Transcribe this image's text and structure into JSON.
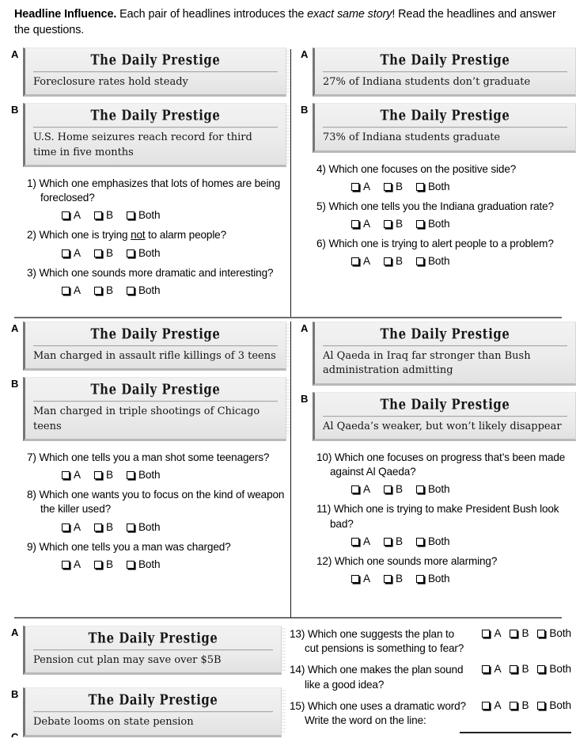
{
  "header": {
    "lead": "Headline Influence.",
    "text_before_italic": " Each pair of headlines introduces the ",
    "italic": "exact same story",
    "text_after_italic": "! Read the headlines and answer the questions."
  },
  "masthead": "The Daily Prestige",
  "choice_labels": {
    "a": "A",
    "b": "B",
    "both": "Both"
  },
  "quadrants": [
    {
      "id": "top-left",
      "papers": [
        {
          "label": "A",
          "headline": "Foreclosure rates  hold steady"
        },
        {
          "label": "B",
          "headline": "U.S. Home seizures reach record for third time in five months"
        }
      ],
      "questions": [
        {
          "number": "1)",
          "text_parts": [
            {
              "t": "Which one emphasizes that lots of homes are being foreclosed?"
            }
          ]
        },
        {
          "number": "2)",
          "text_parts": [
            {
              "t": "Which one is trying "
            },
            {
              "t": "not",
              "u": true
            },
            {
              "t": " to alarm people?"
            }
          ]
        },
        {
          "number": "3)",
          "text_parts": [
            {
              "t": "Which one sounds more dramatic and interesting?"
            }
          ]
        }
      ]
    },
    {
      "id": "top-right",
      "papers": [
        {
          "label": "A",
          "headline": "27% of Indiana students don’t graduate"
        },
        {
          "label": "B",
          "headline": "73% of Indiana students graduate"
        }
      ],
      "questions": [
        {
          "number": "4)",
          "text_parts": [
            {
              "t": "Which one focuses on the positive side?"
            }
          ]
        },
        {
          "number": "5)",
          "text_parts": [
            {
              "t": "Which one tells you the Indiana graduation rate?"
            }
          ]
        },
        {
          "number": "6)",
          "text_parts": [
            {
              "t": "Which one is trying to alert people to a problem?"
            }
          ]
        }
      ]
    },
    {
      "id": "bottom-left",
      "papers": [
        {
          "label": "A",
          "headline": "Man charged in assault rifle killings of 3 teens"
        },
        {
          "label": "B",
          "headline": "Man charged in triple shootings of Chicago teens"
        }
      ],
      "questions": [
        {
          "number": "7)",
          "text_parts": [
            {
              "t": "Which one tells you a man shot some teenagers?"
            }
          ]
        },
        {
          "number": "8)",
          "text_parts": [
            {
              "t": "Which one wants you to focus on the kind of weapon the killer used?"
            }
          ]
        },
        {
          "number": "9)",
          "text_parts": [
            {
              "t": "Which one tells you a man was charged?"
            }
          ]
        }
      ]
    },
    {
      "id": "bottom-right",
      "papers": [
        {
          "label": "A",
          "headline": "Al Qaeda in Iraq far stronger than Bush administration admitting"
        },
        {
          "label": "B",
          "headline": "Al Qaeda’s weaker, but won’t likely disappear"
        }
      ],
      "questions": [
        {
          "number": "10)",
          "text_parts": [
            {
              "t": "Which one focuses on progress that’s been made against Al Qaeda?"
            }
          ]
        },
        {
          "number": "11)",
          "text_parts": [
            {
              "t": "Which one is trying to make President Bush look bad?"
            }
          ]
        },
        {
          "number": "12)",
          "text_parts": [
            {
              "t": "Which one sounds more alarming?"
            }
          ]
        }
      ]
    }
  ],
  "bottom_section": {
    "papers": [
      {
        "label": "A",
        "headline": "Pension cut plan may save over $5B"
      },
      {
        "label": "B",
        "headline": "Debate looms on state pension"
      }
    ],
    "stub_label": "C",
    "questions": [
      {
        "number": "13)",
        "text": "Which one suggests the plan to cut pensions is something to fear?"
      },
      {
        "number": "14)",
        "text": "Which one makes the plan sound like a good idea?"
      },
      {
        "number": "15)",
        "text": "Which one uses a dramatic word? Write the word on the line:"
      }
    ]
  }
}
